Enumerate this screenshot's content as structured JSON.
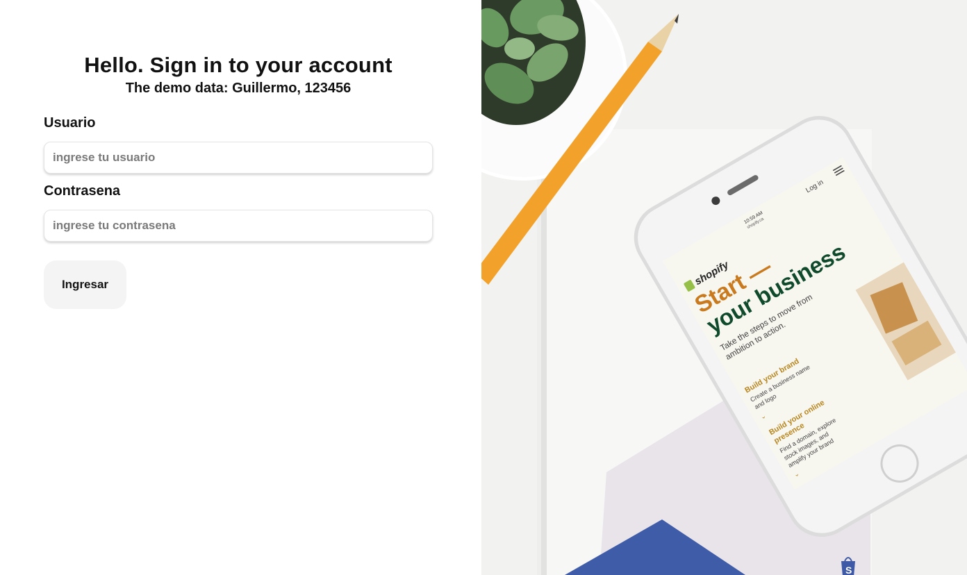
{
  "form": {
    "title": "Hello. Sign in to your account",
    "subtitle": "The demo data: Guillermo, 123456",
    "username_label": "Usuario",
    "username_placeholder": "ingrese tu usuario",
    "username_value": "",
    "password_label": "Contrasena",
    "password_placeholder": "ingrese tu contrasena",
    "password_value": "",
    "submit_label": "Ingresar"
  },
  "hero": {
    "phone_screen": {
      "time": "10:59 AM",
      "url": "shopify.ca",
      "login": "Log in",
      "brand": "shopify",
      "headline_1": "Start —",
      "headline_2": "your business",
      "tagline_1": "Take the steps to move from",
      "tagline_2": "ambition to action.",
      "step1_title": "Build your brand",
      "step1_desc_1": "Create a business name",
      "step1_desc_2": "and logo",
      "step2_title_1": "Build your online",
      "step2_title_2": "presence",
      "step2_desc_1": "Find a domain, explore",
      "step2_desc_2": "stock images, and",
      "step2_desc_3": "amplify your brand"
    },
    "colors": {
      "headline_orange": "#c97a1e",
      "headline_green": "#0f4a2c",
      "pencil_yellow": "#f2a22a"
    }
  }
}
